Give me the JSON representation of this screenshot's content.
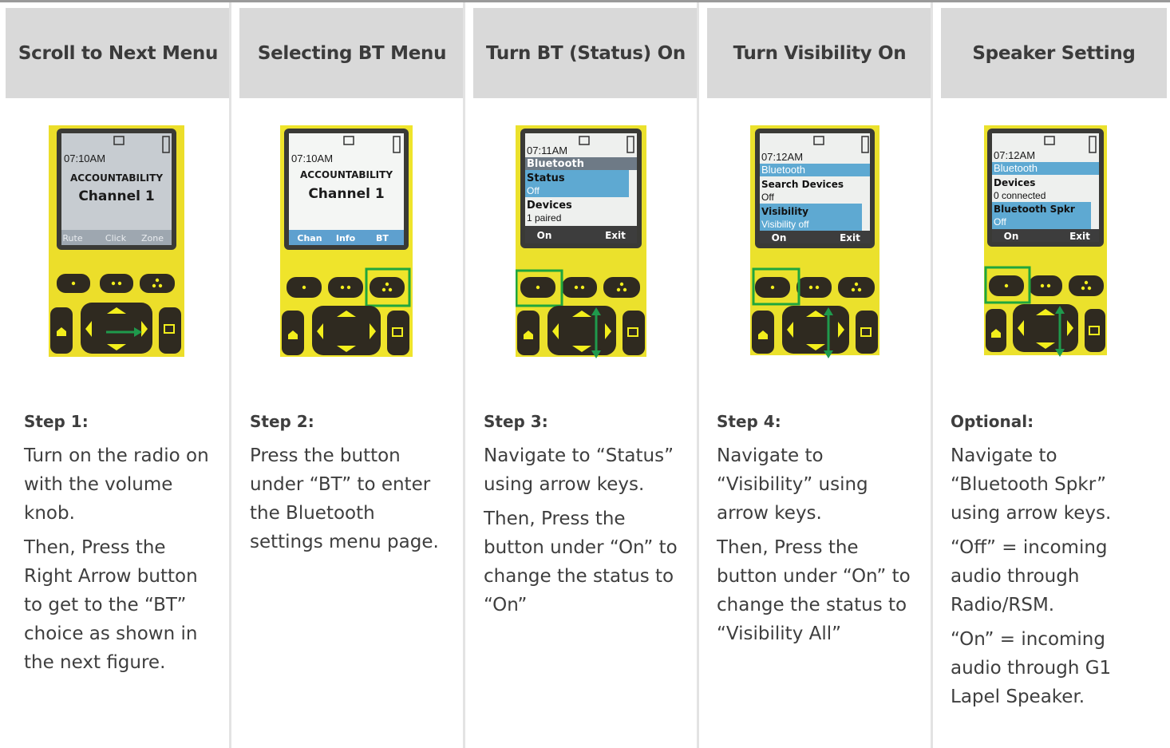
{
  "columns": [
    {
      "header": "Scroll to Next Menu",
      "step_label": "Step 1:",
      "paragraphs": [
        "Turn on the radio on with the volume knob.",
        "Then, Press the Right Arrow button to get to the “BT” choice as shown in the next figure."
      ],
      "screen": {
        "time": "07:10AM",
        "lines": [
          "ACCOUNTABILITY",
          "Channel 1"
        ],
        "softkeys": [
          "Rute",
          "Click",
          "Zone"
        ]
      }
    },
    {
      "header": "Selecting BT Menu",
      "step_label": "Step 2:",
      "paragraphs": [
        "Press the button under “BT” to enter the Bluetooth settings menu page."
      ],
      "screen": {
        "time": "07:10AM",
        "lines": [
          "ACCOUNTABILITY",
          "Channel 1"
        ],
        "softkeys": [
          "Chan",
          "Info",
          "BT"
        ]
      }
    },
    {
      "header": "Turn BT (Status) On",
      "step_label": "Step 3:",
      "paragraphs": [
        "Navigate to “Status” using arrow keys.",
        "Then, Press the button under “On” to change the status to “On”"
      ],
      "screen": {
        "time": "07:11AM",
        "title": "Bluetooth",
        "items": [
          "Status",
          "Off",
          "Devices",
          "1 paired"
        ],
        "softkeys": [
          "On",
          "Exit"
        ]
      }
    },
    {
      "header": "Turn Visibility On",
      "step_label": "Step 4:",
      "paragraphs": [
        "Navigate to “Visibility” using arrow keys.",
        "Then, Press the button under “On” to change the status to “Visibility All”"
      ],
      "screen": {
        "time": "07:12AM",
        "title": "Bluetooth",
        "items": [
          "Search Devices",
          "Off",
          "Visibility",
          "Visibility off"
        ],
        "softkeys": [
          "On",
          "Exit"
        ]
      }
    },
    {
      "header": "Speaker Setting",
      "step_label": "Optional:",
      "paragraphs": [
        "Navigate to “Bluetooth Spkr” using arrow keys.",
        "“Off” = incoming audio through Radio/RSM.",
        "“On” = incoming audio through G1 Lapel Speaker."
      ],
      "screen": {
        "time": "07:12AM",
        "title": "Bluetooth",
        "items": [
          "Devices",
          "0 connected",
          "Bluetooth Spkr",
          "Off"
        ],
        "softkeys": [
          "On",
          "Exit"
        ]
      }
    }
  ],
  "colors": {
    "radio_body": "#f2ee1c",
    "lcd": "#c9cdd2",
    "lcd_white": "#f4f6f4",
    "lcd_highlight": "#5ea9d2",
    "highlight_box": "#1fa63d",
    "arrow": "#1f9a4c"
  },
  "icons": [
    "one-dot-key-icon",
    "two-dot-key-icon",
    "three-dot-key-icon",
    "home-icon",
    "dpad-icon",
    "menu-icon",
    "signal-icon",
    "battery-icon",
    "ip-icon"
  ]
}
